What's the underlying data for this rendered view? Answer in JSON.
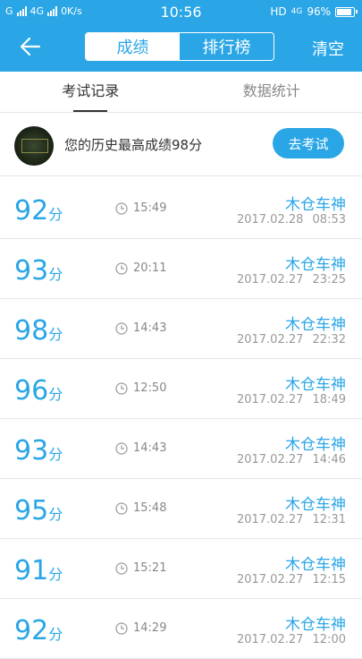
{
  "status_bar": {
    "carrier_left": "G",
    "network": "4G",
    "speed": "0K/s",
    "time": "10:56",
    "hd": "HD",
    "net_right": "4G",
    "battery": "96%"
  },
  "header": {
    "segment_left": "成绩",
    "segment_right": "排行榜",
    "clear_label": "清空"
  },
  "tabs": [
    {
      "label": "考试记录"
    },
    {
      "label": "数据统计"
    }
  ],
  "best": {
    "text": "您的历史最高成绩98分",
    "button": "去考试"
  },
  "records": [
    {
      "score": "92",
      "unit": "分",
      "duration": "15:49",
      "user": "木仓车神",
      "date": "2017.02.28 08:53"
    },
    {
      "score": "93",
      "unit": "分",
      "duration": "20:11",
      "user": "木仓车神",
      "date": "2017.02.27 23:25"
    },
    {
      "score": "98",
      "unit": "分",
      "duration": "14:43",
      "user": "木仓车神",
      "date": "2017.02.27 22:32"
    },
    {
      "score": "96",
      "unit": "分",
      "duration": "12:50",
      "user": "木仓车神",
      "date": "2017.02.27 18:49"
    },
    {
      "score": "93",
      "unit": "分",
      "duration": "14:43",
      "user": "木仓车神",
      "date": "2017.02.27 14:46"
    },
    {
      "score": "95",
      "unit": "分",
      "duration": "15:48",
      "user": "木仓车神",
      "date": "2017.02.27 12:31"
    },
    {
      "score": "91",
      "unit": "分",
      "duration": "15:21",
      "user": "木仓车神",
      "date": "2017.02.27 12:15"
    },
    {
      "score": "92",
      "unit": "分",
      "duration": "14:29",
      "user": "木仓车神",
      "date": "2017.02.27 12:00"
    }
  ]
}
